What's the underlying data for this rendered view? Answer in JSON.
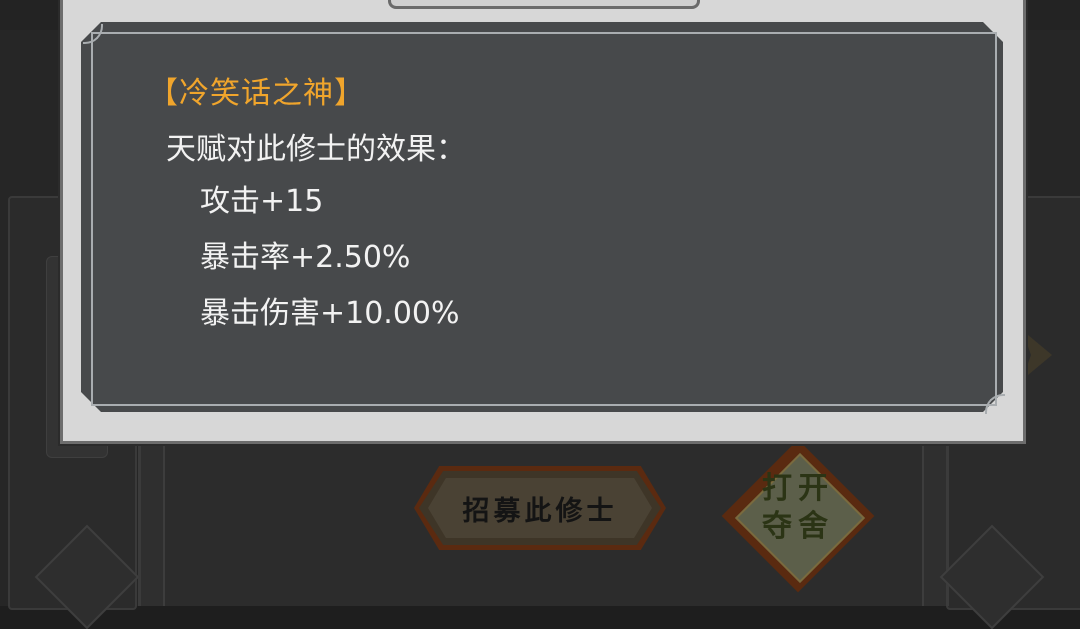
{
  "dialog": {
    "talent_title": "【冷笑话之神】",
    "effect_header": "天赋对此修士的效果：",
    "effects": [
      "攻击+15",
      "暴击率+2.50%",
      "暴击伤害+10.00%"
    ]
  },
  "actions": {
    "recruit_label": "招募此修士",
    "house_label_line1": "打开",
    "house_label_line2": "夺舍"
  },
  "colors": {
    "title_accent": "#f0a52c",
    "panel_bg": "#47494b",
    "dialog_bg": "#d7d7d7"
  }
}
